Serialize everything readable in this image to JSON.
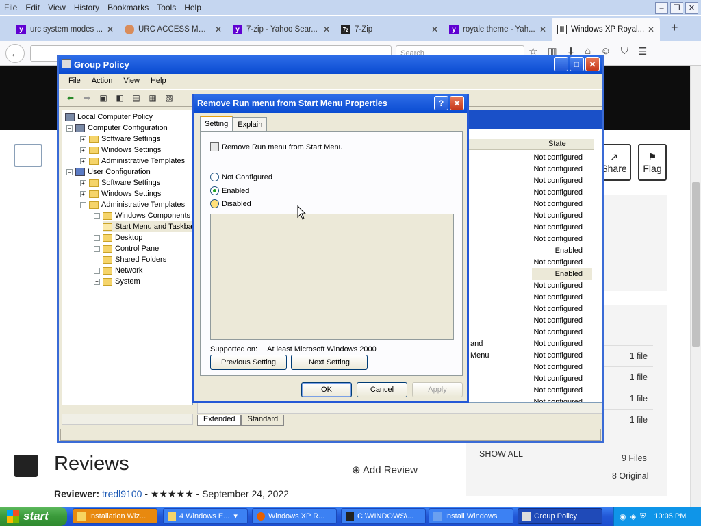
{
  "browser": {
    "menu": [
      "File",
      "Edit",
      "View",
      "History",
      "Bookmarks",
      "Tools",
      "Help"
    ],
    "tabs": [
      {
        "label": "urc system modes ...",
        "icon": "yahoo-icon"
      },
      {
        "label": "URC ACCESS MOD...",
        "icon": "urc-icon"
      },
      {
        "label": "7-zip - Yahoo Sear...",
        "icon": "yahoo-icon"
      },
      {
        "label": "7-Zip",
        "icon": "7zip-icon"
      },
      {
        "label": "royale theme - Yah...",
        "icon": "yahoo-icon"
      },
      {
        "label": "Windows XP Royal...",
        "icon": "archive-icon"
      }
    ],
    "search_placeholder": "Search"
  },
  "page": {
    "share_label": "Share",
    "flag_label": "Flag",
    "files": [
      "1 file",
      "1 file",
      "1 file",
      "1 file"
    ],
    "show_all": "SHOW ALL",
    "files_total": "9 Files",
    "original": "8 Original",
    "reviews_title": "Reviews",
    "add_review": "Add Review",
    "reviewer_label": "Reviewer:",
    "reviewer_name": "tredl9100",
    "reviewer_rest": " - ★★★★★ - September 24, 2022"
  },
  "group_policy": {
    "title": "Group Policy",
    "menu": [
      "File",
      "Action",
      "View",
      "Help"
    ],
    "tree": {
      "root": "Local Computer Policy",
      "computer_config": "Computer Configuration",
      "cc_software": "Software Settings",
      "cc_windows": "Windows Settings",
      "cc_admin": "Administrative Templates",
      "user_config": "User Configuration",
      "uc_software": "Software Settings",
      "uc_windows": "Windows Settings",
      "uc_admin": "Administrative Templates",
      "windows_components": "Windows Components",
      "start_menu": "Start Menu and Taskbar",
      "desktop": "Desktop",
      "control_panel": "Control Panel",
      "shared_folders": "Shared Folders",
      "network": "Network",
      "system": "System"
    },
    "state_header": "State",
    "states": [
      "Not configured",
      "Not configured",
      "Not configured",
      "Not configured",
      "Not configured",
      "Not configured",
      "Not configured",
      "Not configured",
      "Enabled",
      "Not configured",
      "Enabled",
      "Not configured",
      "Not configured",
      "Not configured",
      "Not configured",
      "Not configured",
      "Not configured",
      "Not configured",
      "Not configured",
      "Not configured",
      "Not configured",
      "Not configured"
    ],
    "partial_left": [
      "and",
      "Menu"
    ],
    "view_tabs": [
      "Extended",
      "Standard"
    ]
  },
  "dialog": {
    "title": "Remove Run menu from Start Menu Properties",
    "tabs": [
      "Setting",
      "Explain"
    ],
    "policy_name": "Remove Run menu from Start Menu",
    "options": [
      "Not Configured",
      "Enabled",
      "Disabled"
    ],
    "selected": "Enabled",
    "supported_label": "Supported on:",
    "supported_value": "At least Microsoft Windows 2000",
    "prev_button": "Previous Setting",
    "next_button": "Next Setting",
    "ok": "OK",
    "cancel": "Cancel",
    "apply": "Apply"
  },
  "taskbar": {
    "start": "start",
    "tasks": [
      "Installation Wiz...",
      "4 Windows E...",
      "Windows XP R...",
      "C:\\WINDOWS\\...",
      "Install Windows",
      "Group Policy"
    ],
    "time": "10:05 PM"
  },
  "colors": {
    "xp_blue": "#0a4bd1",
    "start_green": "#3a9a3a",
    "ff_tabbar": "#c5d6f0"
  }
}
